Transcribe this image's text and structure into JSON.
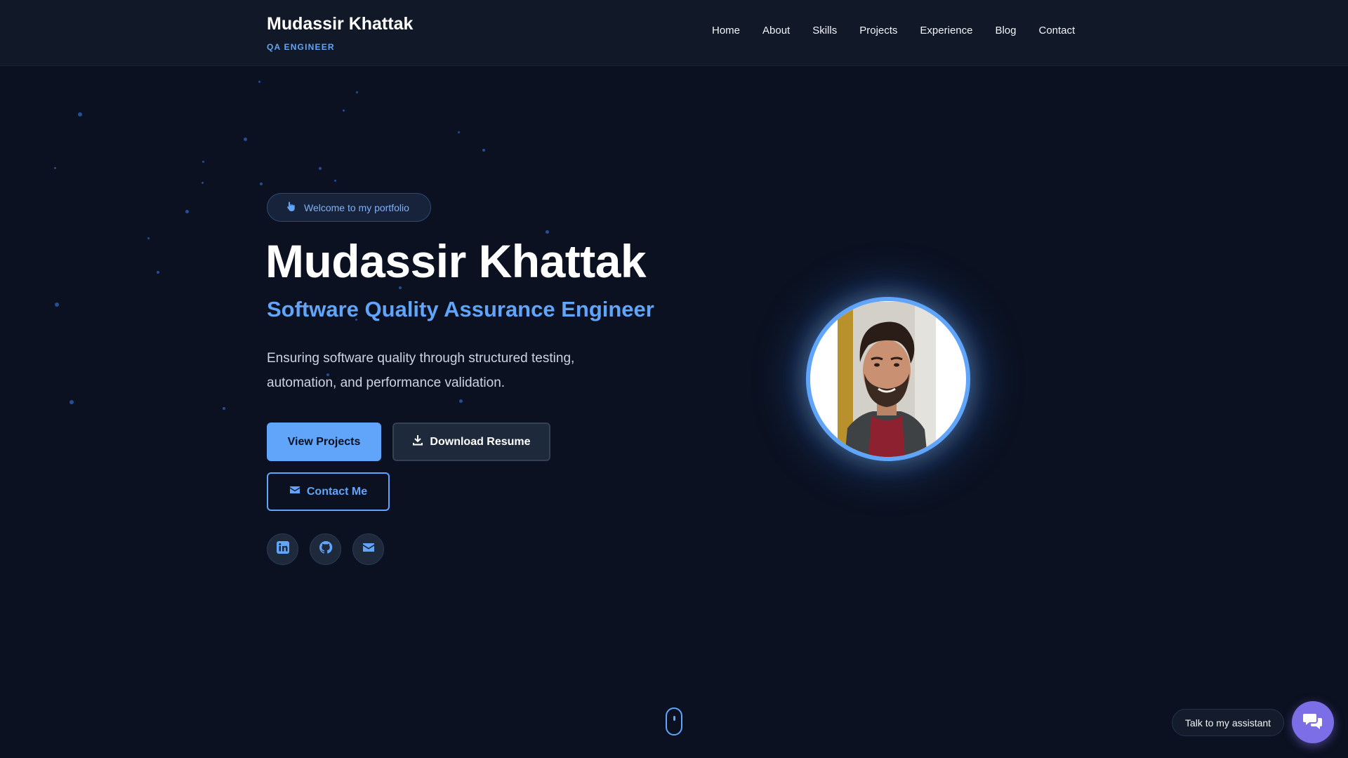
{
  "header": {
    "brand_name": "Mudassir Khattak",
    "brand_role": "QA ENGINEER",
    "nav": [
      "Home",
      "About",
      "Skills",
      "Projects",
      "Experience",
      "Blog",
      "Contact"
    ]
  },
  "hero": {
    "badge": "Welcome to my portfolio",
    "badge_icon": "hand-pointer-icon",
    "name": "Mudassir Khattak",
    "role": "Software Quality Assurance Engineer",
    "description": "Ensuring software quality through structured testing, automation, and performance validation.",
    "buttons": {
      "view_projects": "View Projects",
      "download_resume": "Download Resume",
      "contact_me": "Contact Me"
    },
    "socials": [
      "linkedin-icon",
      "github-icon",
      "envelope-icon"
    ]
  },
  "assistant": {
    "label": "Talk to my assistant",
    "icon": "chat-bubbles-icon"
  },
  "colors": {
    "background": "#0b1120",
    "header": "#111827",
    "accent": "#60a5fa",
    "assistant": "#7c6ee6"
  }
}
